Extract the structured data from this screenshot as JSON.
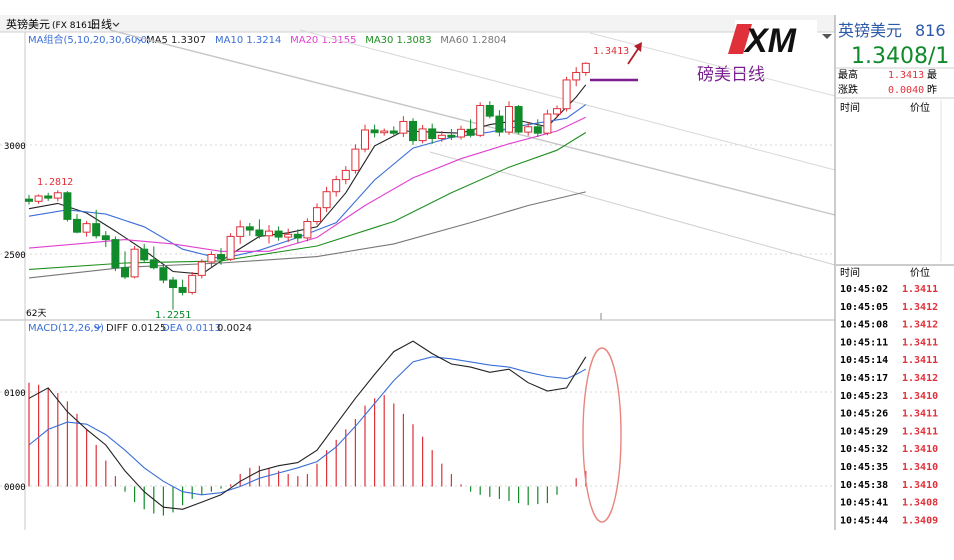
{
  "header": {
    "instrument": "英镑美元",
    "code": "(FX 8161)",
    "period": "日线",
    "period_arrow": "chevron-down"
  },
  "ma_legend": {
    "label": "MA组合(5,10,20,30,60,0)",
    "items": [
      {
        "text": "MA5 1.3307",
        "color": "#222222"
      },
      {
        "text": "MA10 1.3214",
        "color": "#3a6fd6"
      },
      {
        "text": "MA20 1.3155",
        "color": "#e040d0"
      },
      {
        "text": "MA30 1.3083",
        "color": "#1f8f1f"
      },
      {
        "text": "MA60 1.2804",
        "color": "#777777"
      }
    ]
  },
  "macd_legend": {
    "label": "MACD(12,26,9)",
    "diff": "DIFF 0.0125",
    "dea": "DEA 0.0113",
    "macd": "0.0024"
  },
  "axis": {
    "price_ticks": [
      "3000",
      "2500"
    ],
    "macd_ticks": [
      "0100",
      "0000"
    ],
    "days_label": "62天"
  },
  "annotations": {
    "high_label": "1.3413",
    "old_high_label": "1.2812",
    "low_label": "1.2251",
    "title_overlay": "磅美日线",
    "logo_text": "XM"
  },
  "quote_panel": {
    "name": "英镑美元",
    "code": "816",
    "price": "1.3408/1",
    "rows": [
      {
        "label": "最高",
        "value": "1.3413",
        "extra": "最"
      },
      {
        "label": "涨跌",
        "value": "0.0040",
        "extra": "昨"
      }
    ],
    "col_time": "时间",
    "col_price": "价位",
    "trades": [
      {
        "time": "10:45:02",
        "price": "1.3411"
      },
      {
        "time": "10:45:05",
        "price": "1.3412"
      },
      {
        "time": "10:45:08",
        "price": "1.3412"
      },
      {
        "time": "10:45:11",
        "price": "1.3411"
      },
      {
        "time": "10:45:14",
        "price": "1.3411"
      },
      {
        "time": "10:45:17",
        "price": "1.3412"
      },
      {
        "time": "10:45:23",
        "price": "1.3410"
      },
      {
        "time": "10:45:26",
        "price": "1.3411"
      },
      {
        "time": "10:45:29",
        "price": "1.3411"
      },
      {
        "time": "10:45:32",
        "price": "1.3410"
      },
      {
        "time": "10:45:35",
        "price": "1.3410"
      },
      {
        "time": "10:45:38",
        "price": "1.3410"
      },
      {
        "time": "10:45:41",
        "price": "1.3408"
      },
      {
        "time": "10:45:44",
        "price": "1.3409"
      }
    ]
  },
  "colors": {
    "up": "#e0303a",
    "down": "#108a2a",
    "ma5": "#222222",
    "ma10": "#3a6fd6",
    "ma20": "#e040d0",
    "ma30": "#1f8f1f",
    "ma60": "#777777",
    "accent_purple": "#7a1f8f"
  },
  "chart_data": [
    {
      "type": "candlestick",
      "ylim": [
        1.224,
        1.348
      ],
      "candles": [
        [
          1.277,
          1.279,
          1.2745,
          1.276
        ],
        [
          1.276,
          1.2792,
          1.2748,
          1.2785
        ],
        [
          1.2785,
          1.28,
          1.2762,
          1.2775
        ],
        [
          1.2775,
          1.2812,
          1.276,
          1.28
        ],
        [
          1.28,
          1.2808,
          1.2665,
          1.2675
        ],
        [
          1.2675,
          1.27,
          1.261,
          1.2615
        ],
        [
          1.2615,
          1.2668,
          1.2594,
          1.2655
        ],
        [
          1.2655,
          1.272,
          1.2585,
          1.2598
        ],
        [
          1.2598,
          1.262,
          1.2545,
          1.258
        ],
        [
          1.258,
          1.2595,
          1.2432,
          1.2448
        ],
        [
          1.2448,
          1.2525,
          1.2395,
          1.2405
        ],
        [
          1.2405,
          1.255,
          1.2398,
          1.2535
        ],
        [
          1.2535,
          1.256,
          1.2475,
          1.2485
        ],
        [
          1.2485,
          1.2548,
          1.244,
          1.2448
        ],
        [
          1.2448,
          1.2462,
          1.2375,
          1.239
        ],
        [
          1.239,
          1.2405,
          1.2251,
          1.2355
        ],
        [
          1.2355,
          1.2392,
          1.2318,
          1.2332
        ],
        [
          1.2332,
          1.2428,
          1.2322,
          1.2412
        ],
        [
          1.2412,
          1.2488,
          1.2398,
          1.2475
        ],
        [
          1.2475,
          1.2525,
          1.245,
          1.251
        ],
        [
          1.251,
          1.254,
          1.2462,
          1.2488
        ],
        [
          1.2488,
          1.261,
          1.248,
          1.2595
        ],
        [
          1.2595,
          1.267,
          1.256,
          1.264
        ],
        [
          1.264,
          1.2658,
          1.2598,
          1.2625
        ],
        [
          1.2625,
          1.2675,
          1.2585,
          1.2598
        ],
        [
          1.2598,
          1.2648,
          1.2562,
          1.262
        ],
        [
          1.262,
          1.2642,
          1.2575,
          1.2592
        ],
        [
          1.2592,
          1.2632,
          1.2568,
          1.2605
        ],
        [
          1.2605,
          1.2628,
          1.2565,
          1.2588
        ],
        [
          1.2588,
          1.268,
          1.2572,
          1.2665
        ],
        [
          1.2665,
          1.275,
          1.265,
          1.273
        ],
        [
          1.273,
          1.2828,
          1.271,
          1.2805
        ],
        [
          1.2805,
          1.288,
          1.2782,
          1.2862
        ],
        [
          1.2862,
          1.2925,
          1.284,
          1.2905
        ],
        [
          1.2905,
          1.3028,
          1.289,
          1.3005
        ],
        [
          1.3005,
          1.312,
          1.299,
          1.3095
        ],
        [
          1.3095,
          1.312,
          1.306,
          1.3082
        ],
        [
          1.3082,
          1.3102,
          1.3068,
          1.309
        ],
        [
          1.309,
          1.3112,
          1.307,
          1.308
        ],
        [
          1.308,
          1.316,
          1.3062,
          1.3135
        ],
        [
          1.3135,
          1.315,
          1.3025,
          1.3045
        ],
        [
          1.3045,
          1.3118,
          1.3032,
          1.31
        ],
        [
          1.31,
          1.3125,
          1.303,
          1.3055
        ],
        [
          1.3055,
          1.309,
          1.304,
          1.307
        ],
        [
          1.307,
          1.31,
          1.3048,
          1.3062
        ],
        [
          1.3062,
          1.3115,
          1.305,
          1.3098
        ],
        [
          1.3098,
          1.3145,
          1.306,
          1.307
        ],
        [
          1.307,
          1.3225,
          1.3062,
          1.321
        ],
        [
          1.321,
          1.323,
          1.315,
          1.316
        ],
        [
          1.316,
          1.3188,
          1.3065,
          1.3085
        ],
        [
          1.3085,
          1.323,
          1.3072,
          1.3205
        ],
        [
          1.3205,
          1.3212,
          1.3075,
          1.3085
        ],
        [
          1.3085,
          1.313,
          1.3068,
          1.311
        ],
        [
          1.311,
          1.3145,
          1.3062,
          1.308
        ],
        [
          1.308,
          1.319,
          1.307,
          1.317
        ],
        [
          1.317,
          1.321,
          1.315,
          1.3195
        ],
        [
          1.3195,
          1.3345,
          1.3182,
          1.333
        ],
        [
          1.333,
          1.339,
          1.33,
          1.3365
        ],
        [
          1.3365,
          1.3413,
          1.335,
          1.3408
        ]
      ],
      "ma_lines": [
        {
          "name": "MA5",
          "points": [
            [
              0,
              1.2725
            ],
            [
              3,
              1.275
            ],
            [
              6,
              1.2705
            ],
            [
              9,
              1.262
            ],
            [
              12,
              1.253
            ],
            [
              15,
              1.243
            ],
            [
              18,
              1.2418
            ],
            [
              21,
              1.251
            ],
            [
              24,
              1.2595
            ],
            [
              27,
              1.2612
            ],
            [
              30,
              1.264
            ],
            [
              33,
              1.28
            ],
            [
              36,
              1.302
            ],
            [
              39,
              1.309
            ],
            [
              42,
              1.3085
            ],
            [
              45,
              1.308
            ],
            [
              48,
              1.312
            ],
            [
              51,
              1.314
            ],
            [
              54,
              1.311
            ],
            [
              57,
              1.325
            ],
            [
              58,
              1.3307
            ]
          ]
        },
        {
          "name": "MA10",
          "points": [
            [
              0,
              1.269
            ],
            [
              4,
              1.272
            ],
            [
              8,
              1.27
            ],
            [
              12,
              1.264
            ],
            [
              16,
              1.2535
            ],
            [
              20,
              1.249
            ],
            [
              24,
              1.253
            ],
            [
              28,
              1.259
            ],
            [
              32,
              1.266
            ],
            [
              36,
              1.286
            ],
            [
              40,
              1.301
            ],
            [
              44,
              1.306
            ],
            [
              48,
              1.3085
            ],
            [
              52,
              1.312
            ],
            [
              56,
              1.315
            ],
            [
              58,
              1.3214
            ]
          ]
        },
        {
          "name": "MA20",
          "points": [
            [
              0,
              1.254
            ],
            [
              5,
              1.256
            ],
            [
              10,
              1.258
            ],
            [
              15,
              1.256
            ],
            [
              20,
              1.2525
            ],
            [
              25,
              1.2525
            ],
            [
              30,
              1.259
            ],
            [
              35,
              1.274
            ],
            [
              40,
              1.287
            ],
            [
              45,
              1.296
            ],
            [
              50,
              1.303
            ],
            [
              55,
              1.309
            ],
            [
              58,
              1.3155
            ]
          ]
        },
        {
          "name": "MA30",
          "points": [
            [
              0,
              1.244
            ],
            [
              10,
              1.247
            ],
            [
              20,
              1.248
            ],
            [
              30,
              1.255
            ],
            [
              38,
              1.2665
            ],
            [
              44,
              1.28
            ],
            [
              50,
              1.292
            ],
            [
              55,
              1.3
            ],
            [
              58,
              1.3083
            ]
          ]
        },
        {
          "name": "MA60",
          "points": [
            [
              0,
              1.24
            ],
            [
              10,
              1.245
            ],
            [
              20,
              1.247
            ],
            [
              30,
              1.25
            ],
            [
              38,
              1.256
            ],
            [
              46,
              1.266
            ],
            [
              52,
              1.274
            ],
            [
              58,
              1.2804
            ]
          ]
        }
      ]
    },
    {
      "type": "macd",
      "ylim": [
        -0.004,
        0.0145
      ],
      "diff": [
        [
          0,
          0.0085
        ],
        [
          2,
          0.0095
        ],
        [
          4,
          0.0072
        ],
        [
          6,
          0.0055
        ],
        [
          8,
          0.004
        ],
        [
          10,
          0.0015
        ],
        [
          12,
          -0.0005
        ],
        [
          14,
          -0.002
        ],
        [
          16,
          -0.0022
        ],
        [
          18,
          -0.0015
        ],
        [
          20,
          -0.0008
        ],
        [
          22,
          0.0005
        ],
        [
          24,
          0.0015
        ],
        [
          26,
          0.002
        ],
        [
          28,
          0.0023
        ],
        [
          30,
          0.0035
        ],
        [
          32,
          0.006
        ],
        [
          34,
          0.0085
        ],
        [
          36,
          0.0108
        ],
        [
          38,
          0.013
        ],
        [
          40,
          0.014
        ],
        [
          42,
          0.0128
        ],
        [
          44,
          0.0118
        ],
        [
          46,
          0.0115
        ],
        [
          48,
          0.011
        ],
        [
          50,
          0.0113
        ],
        [
          52,
          0.01
        ],
        [
          54,
          0.0092
        ],
        [
          56,
          0.0095
        ],
        [
          57,
          0.011
        ],
        [
          58,
          0.0125
        ]
      ],
      "dea": [
        [
          0,
          0.004
        ],
        [
          2,
          0.0055
        ],
        [
          4,
          0.0062
        ],
        [
          6,
          0.006
        ],
        [
          8,
          0.005
        ],
        [
          10,
          0.0035
        ],
        [
          12,
          0.0018
        ],
        [
          14,
          0.0005
        ],
        [
          16,
          -0.0005
        ],
        [
          18,
          -0.0008
        ],
        [
          20,
          -0.0006
        ],
        [
          22,
          0.0
        ],
        [
          24,
          0.0008
        ],
        [
          26,
          0.0013
        ],
        [
          28,
          0.0018
        ],
        [
          30,
          0.0024
        ],
        [
          32,
          0.0038
        ],
        [
          34,
          0.0058
        ],
        [
          36,
          0.008
        ],
        [
          38,
          0.0102
        ],
        [
          40,
          0.012
        ],
        [
          42,
          0.0125
        ],
        [
          44,
          0.0123
        ],
        [
          46,
          0.012
        ],
        [
          48,
          0.0117
        ],
        [
          50,
          0.0115
        ],
        [
          52,
          0.011
        ],
        [
          54,
          0.0106
        ],
        [
          56,
          0.0104
        ],
        [
          57,
          0.0108
        ],
        [
          58,
          0.0113
        ]
      ],
      "hist": [
        0.01,
        0.0098,
        0.0095,
        0.009,
        0.0082,
        0.007,
        0.0055,
        0.004,
        0.0025,
        0.001,
        -0.0005,
        -0.0015,
        -0.0022,
        -0.0026,
        -0.0028,
        -0.0025,
        -0.0018,
        -0.0012,
        -0.0008,
        -0.0005,
        -0.0002,
        0.0002,
        0.0012,
        0.0018,
        0.002,
        0.0018,
        0.0015,
        0.0012,
        0.001,
        0.0012,
        0.0022,
        0.0035,
        0.0045,
        0.0055,
        0.0065,
        0.0078,
        0.0085,
        0.0088,
        0.008,
        0.007,
        0.006,
        0.0048,
        0.0035,
        0.0022,
        0.0012,
        0.0002,
        -0.0005,
        -0.0008,
        -0.001,
        -0.0012,
        -0.0014,
        -0.0016,
        -0.0018,
        -0.0017,
        -0.0016,
        -0.0008,
        0.0,
        0.0008,
        0.0015
      ]
    }
  ]
}
